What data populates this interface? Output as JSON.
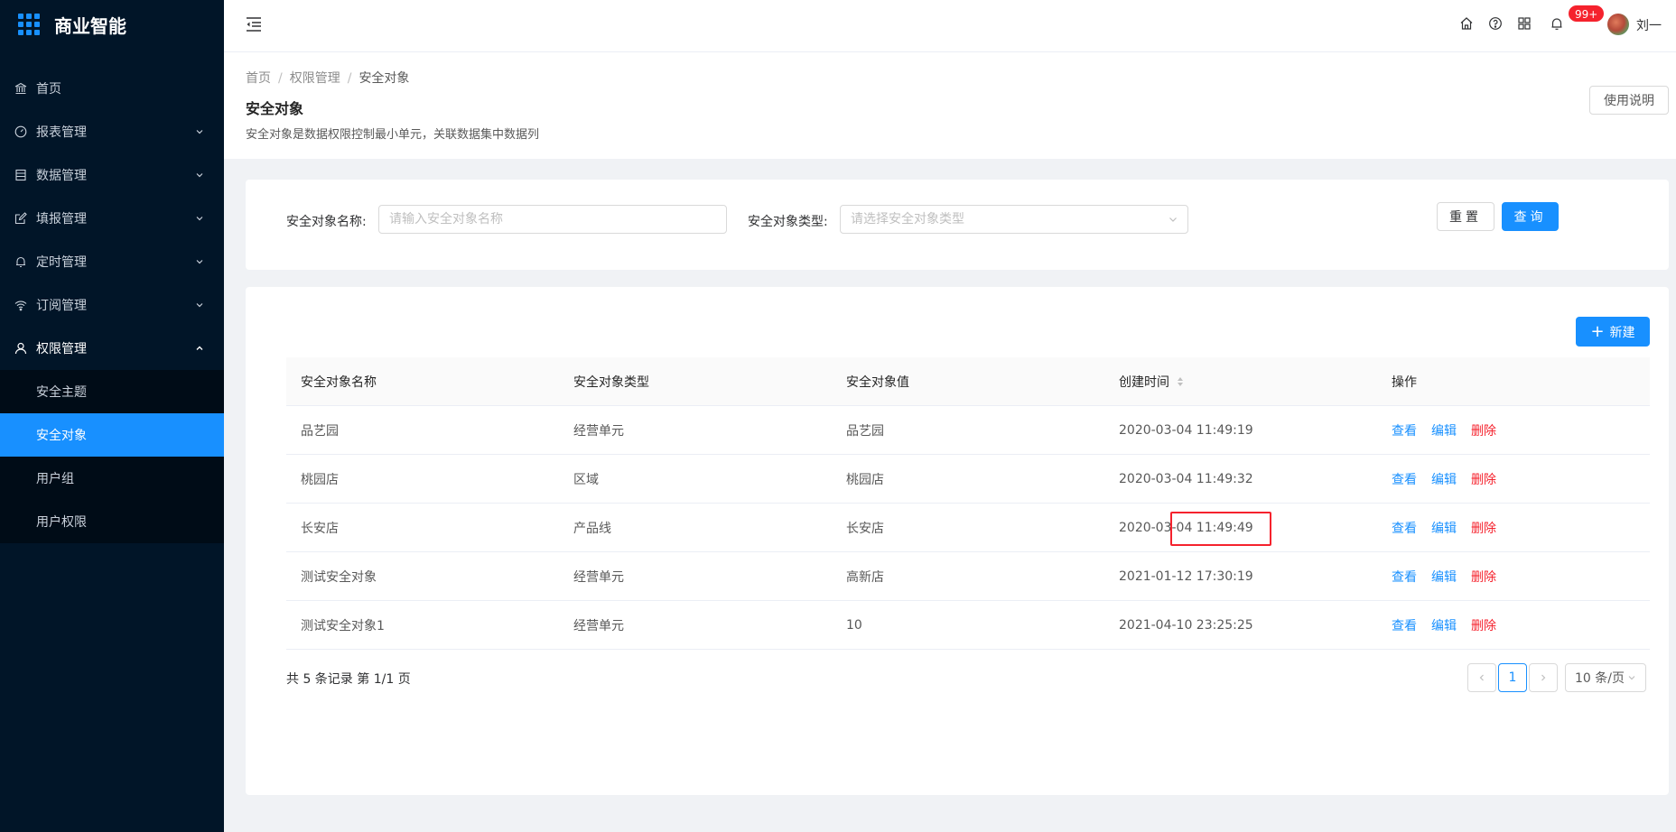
{
  "app": {
    "logo_text": "商业智能"
  },
  "sidebar": {
    "items": [
      {
        "label": "首页",
        "icon": "bank-icon",
        "has_arrow": false
      },
      {
        "label": "报表管理",
        "icon": "dashboard-icon",
        "has_arrow": true
      },
      {
        "label": "数据管理",
        "icon": "database-icon",
        "has_arrow": true
      },
      {
        "label": "填报管理",
        "icon": "form-edit-icon",
        "has_arrow": true
      },
      {
        "label": "定时管理",
        "icon": "bell-icon",
        "has_arrow": true
      },
      {
        "label": "订阅管理",
        "icon": "wifi-icon",
        "has_arrow": true
      },
      {
        "label": "权限管理",
        "icon": "user-icon",
        "has_arrow": true,
        "open": true
      }
    ],
    "submenu": [
      {
        "label": "安全主题",
        "active": false
      },
      {
        "label": "安全对象",
        "active": true
      },
      {
        "label": "用户组",
        "active": false
      },
      {
        "label": "用户权限",
        "active": false
      }
    ]
  },
  "header": {
    "badge": "99+",
    "username": "刘一"
  },
  "breadcrumb": {
    "home": "首页",
    "parent": "权限管理",
    "current": "安全对象"
  },
  "page": {
    "title": "安全对象",
    "description": "安全对象是数据权限控制最小单元，关联数据集中数据列",
    "help_label": "使用说明"
  },
  "search": {
    "name_label": "安全对象名称:",
    "name_placeholder": "请输入安全对象名称",
    "type_label": "安全对象类型:",
    "type_placeholder": "请选择安全对象类型",
    "reset_label": "重置",
    "query_label": "查询"
  },
  "table": {
    "new_label": "新建",
    "columns": [
      "安全对象名称",
      "安全对象类型",
      "安全对象值",
      "创建时间",
      "操作"
    ],
    "rows": [
      {
        "name": "品艺园",
        "type": "经营单元",
        "value": "品艺园",
        "created": "2020-03-04 11:49:19"
      },
      {
        "name": "桃园店",
        "type": "区域",
        "value": "桃园店",
        "created": "2020-03-04 11:49:32"
      },
      {
        "name": "长安店",
        "type": "产品线",
        "value": "长安店",
        "created": "2020-03-04 11:49:49"
      },
      {
        "name": "测试安全对象",
        "type": "经营单元",
        "value": "高新店",
        "created": "2021-01-12 17:30:19"
      },
      {
        "name": "测试安全对象1",
        "type": "经营单元",
        "value": "10",
        "created": "2021-04-10 23:25:25"
      }
    ],
    "actions": {
      "view": "查看",
      "edit": "编辑",
      "delete": "删除"
    }
  },
  "pagination": {
    "summary": "共 5 条记录 第 1/1 页",
    "current_page": "1",
    "page_size": "10 条/页"
  },
  "colors": {
    "primary": "#1890ff",
    "danger": "#f5222d",
    "sidebar_bg": "#011528"
  }
}
